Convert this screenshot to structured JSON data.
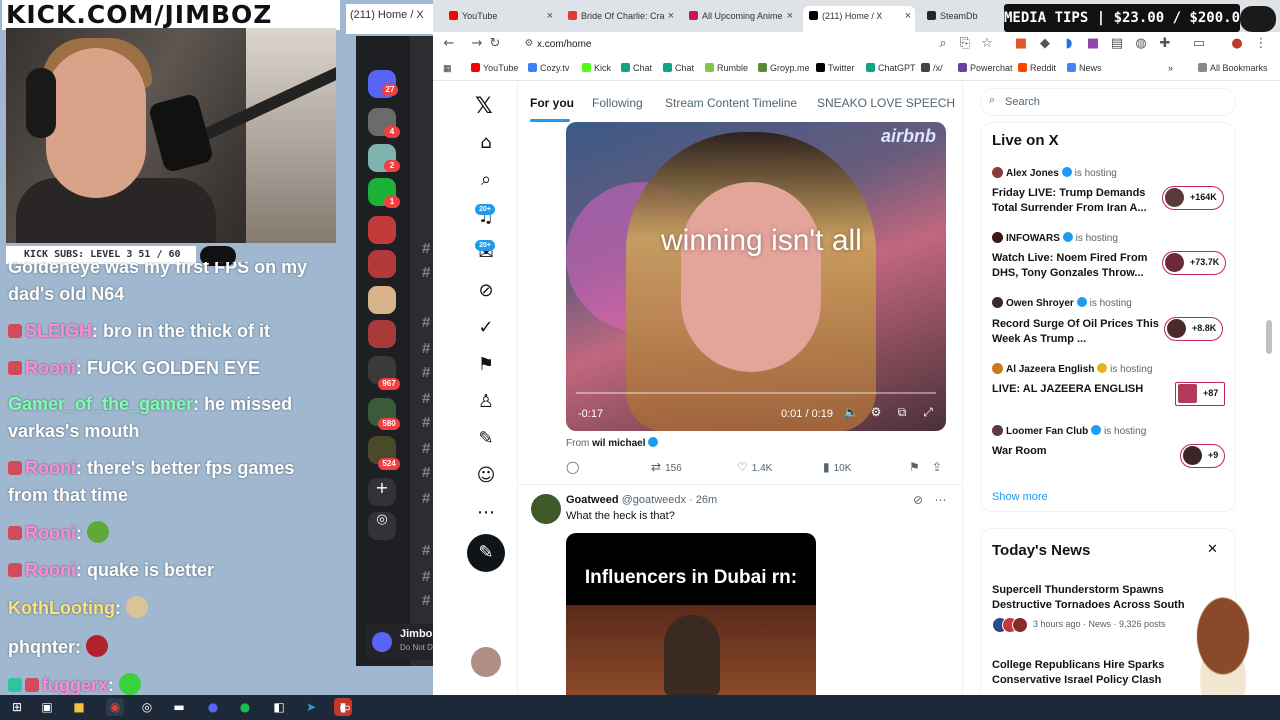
{
  "overlay": {
    "title": "KICK.COM/JIMBOZ",
    "subs_bar": "KICK SUBS: LEVEL 3  51 / 60",
    "chat": [
      {
        "user": "",
        "text": "Goldeneye was my first FPS on my dad's old N64",
        "color": "#ffffff"
      },
      {
        "user": "SLEIGH",
        "text": "bro in the thick of it",
        "color": "#ff8ad8"
      },
      {
        "user": "Rooni",
        "text": "FUCK GOLDEN EYE",
        "color": "#ff8ad8"
      },
      {
        "user": "Gamer_of_the_gamer",
        "text": "he missed varkas's mouth",
        "color": "#7dffb0"
      },
      {
        "user": "Rooni",
        "text": "there's better fps games from that time",
        "color": "#ff8ad8"
      },
      {
        "user": "Rooni",
        "text": "",
        "color": "#ff8ad8"
      },
      {
        "user": "Rooni",
        "text": "quake is better",
        "color": "#ff8ad8"
      },
      {
        "user": "KothLooting",
        "text": "",
        "color": "#ffe27a"
      },
      {
        "user": "phqnter",
        "text": "",
        "color": "#ffffff"
      },
      {
        "user": "fuggerx",
        "text": "",
        "color": "#ff8ad8"
      }
    ]
  },
  "discord": {
    "window_title": "(211) Home / X",
    "user_name": "Jimbo",
    "user_status": "Do Not D",
    "badges": [
      "27",
      "4",
      "2",
      "1",
      "967",
      "580",
      "524"
    ]
  },
  "browser": {
    "tabs": [
      {
        "label": "YouTube",
        "color": "#ff0000",
        "active": false
      },
      {
        "label": "Bride Of Charlie: Cra",
        "color": "#e53935",
        "active": false
      },
      {
        "label": "All Upcoming Anime",
        "color": "#c2185b",
        "active": false
      },
      {
        "label": "(211) Home / X",
        "color": "#000000",
        "active": true
      },
      {
        "label": "SteamDb",
        "color": "#1b2838",
        "active": false
      }
    ],
    "media_tips": "MEDIA TIPS | $23.00 / $200.00",
    "address": "x.com/home",
    "bookmarks": [
      {
        "label": "YouTube",
        "color": "#ff0000"
      },
      {
        "label": "Cozy.tv",
        "color": "#3b82f6"
      },
      {
        "label": "Kick",
        "color": "#53fc18"
      },
      {
        "label": "Chat",
        "color": "#10a37f"
      },
      {
        "label": "Chat",
        "color": "#10a37f"
      },
      {
        "label": "Rumble",
        "color": "#85c742"
      },
      {
        "label": "Groyp.me",
        "color": "#5a8a3a"
      },
      {
        "label": "Twitter",
        "color": "#000000"
      },
      {
        "label": "ChatGPT",
        "color": "#10a37f"
      },
      {
        "label": "/x/",
        "color": "#444444"
      },
      {
        "label": "Powerchat",
        "color": "#6b3fa0"
      },
      {
        "label": "Reddit",
        "color": "#ff4500"
      },
      {
        "label": "News",
        "color": "#4285f4"
      }
    ],
    "all_bookmarks": "All Bookmarks"
  },
  "x": {
    "nav_badges": [
      "20+",
      "20+"
    ],
    "feed_tabs": [
      "For you",
      "Following",
      "Stream Content Timeline",
      "SNEAKO LOVE SPEECH"
    ],
    "video": {
      "caption": "winning  isn't all",
      "sponsor": "airbnb",
      "time_left": "-0:17",
      "time": "0:01 / 0:19"
    },
    "from_prefix": "From",
    "from_user": "wil michael",
    "actions": {
      "retweets": "156",
      "likes": "1.4K",
      "views": "10K"
    },
    "tweet2": {
      "name": "Goatweed",
      "handle": "@goatweedx · 26m",
      "text": "What the heck is that?",
      "image_caption": "Influencers in Dubai rn:"
    },
    "search_placeholder": "Search",
    "live_title": "Live on X",
    "live": [
      {
        "host": "Alex Jones",
        "hosting": "is hosting",
        "title": "Friday LIVE: Trump Demands Total Surrender From Iran A...",
        "count": "+164K",
        "gold": false
      },
      {
        "host": "INFOWARS",
        "hosting": "is hosting",
        "title": "Watch Live: Noem Fired From DHS, Tony Gonzales Throw...",
        "count": "+73.7K",
        "gold": false
      },
      {
        "host": "Owen Shroyer",
        "hosting": "is hosting",
        "title": "Record Surge Of Oil Prices This Week As Trump ...",
        "count": "+8.8K",
        "gold": false
      },
      {
        "host": "Al Jazeera English",
        "hosting": "is hosting",
        "title": "LIVE: AL JAZEERA ENGLISH",
        "count": "+87",
        "gold": true
      },
      {
        "host": "Loomer Fan Club",
        "hosting": "is hosting",
        "title": "War Room",
        "count": "+9",
        "gold": false
      }
    ],
    "show_more": "Show more",
    "news_title": "Today's News",
    "news": [
      {
        "headline": "Supercell Thunderstorm Spawns Destructive Tornadoes Across South",
        "meta": "3 hours ago · News · 9,326 posts"
      },
      {
        "headline": "College Republicans Hire Sparks Conservative Israel Policy Clash",
        "meta": ""
      }
    ]
  }
}
